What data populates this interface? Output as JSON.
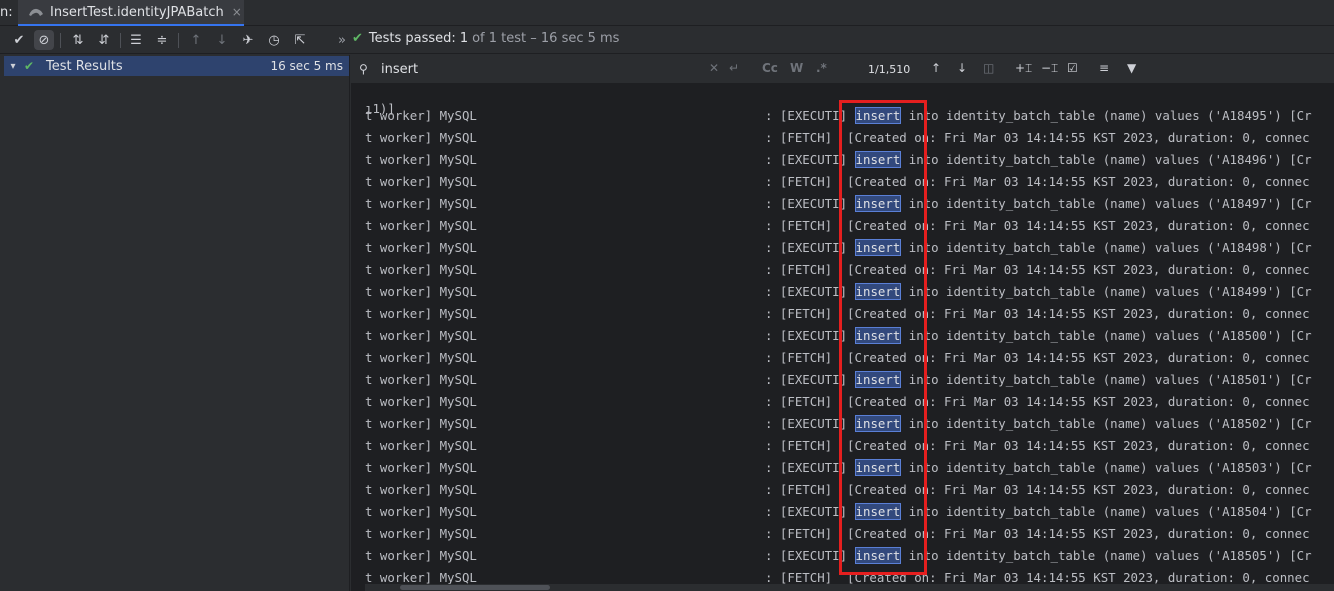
{
  "tabbar": {
    "prefix": "n:",
    "tab_label": "InsertTest.identityJPABatch",
    "close": "×"
  },
  "toolbar": {
    "status_passed": "Tests passed:",
    "status_count": "1",
    "status_rest": "of 1 test – 16 sec 5 ms",
    "more": "»"
  },
  "tree": {
    "root_label": "Test Results",
    "root_time": "16 sec 5 ms"
  },
  "search": {
    "query": "insert",
    "match_count": "1/1,510",
    "match_case": "Cc",
    "words": "W",
    "regex": ".*"
  },
  "console": {
    "first_line": "ı1)]",
    "thread": "t worker] MySQL",
    "execute_prefix": ": [EXECUTI] ",
    "execute_mid": " into identity_batch_table (name) values ('",
    "execute_suffix": "') [Cr",
    "fetch_text": ": [FETCH]  [Created on: Fri Mar 03 14:14:55 KST 2023, duration: 0, connec",
    "match_word": "insert",
    "ids": [
      "A18495",
      "A18496",
      "A18497",
      "A18498",
      "A18499",
      "A18500",
      "A18501",
      "A18502",
      "A18503",
      "A18504",
      "A18505"
    ]
  },
  "colors": {
    "accent": "#3574f0",
    "success": "#5fb865",
    "highlight_box": "#e51f1f",
    "match_bg": "#32497d"
  }
}
